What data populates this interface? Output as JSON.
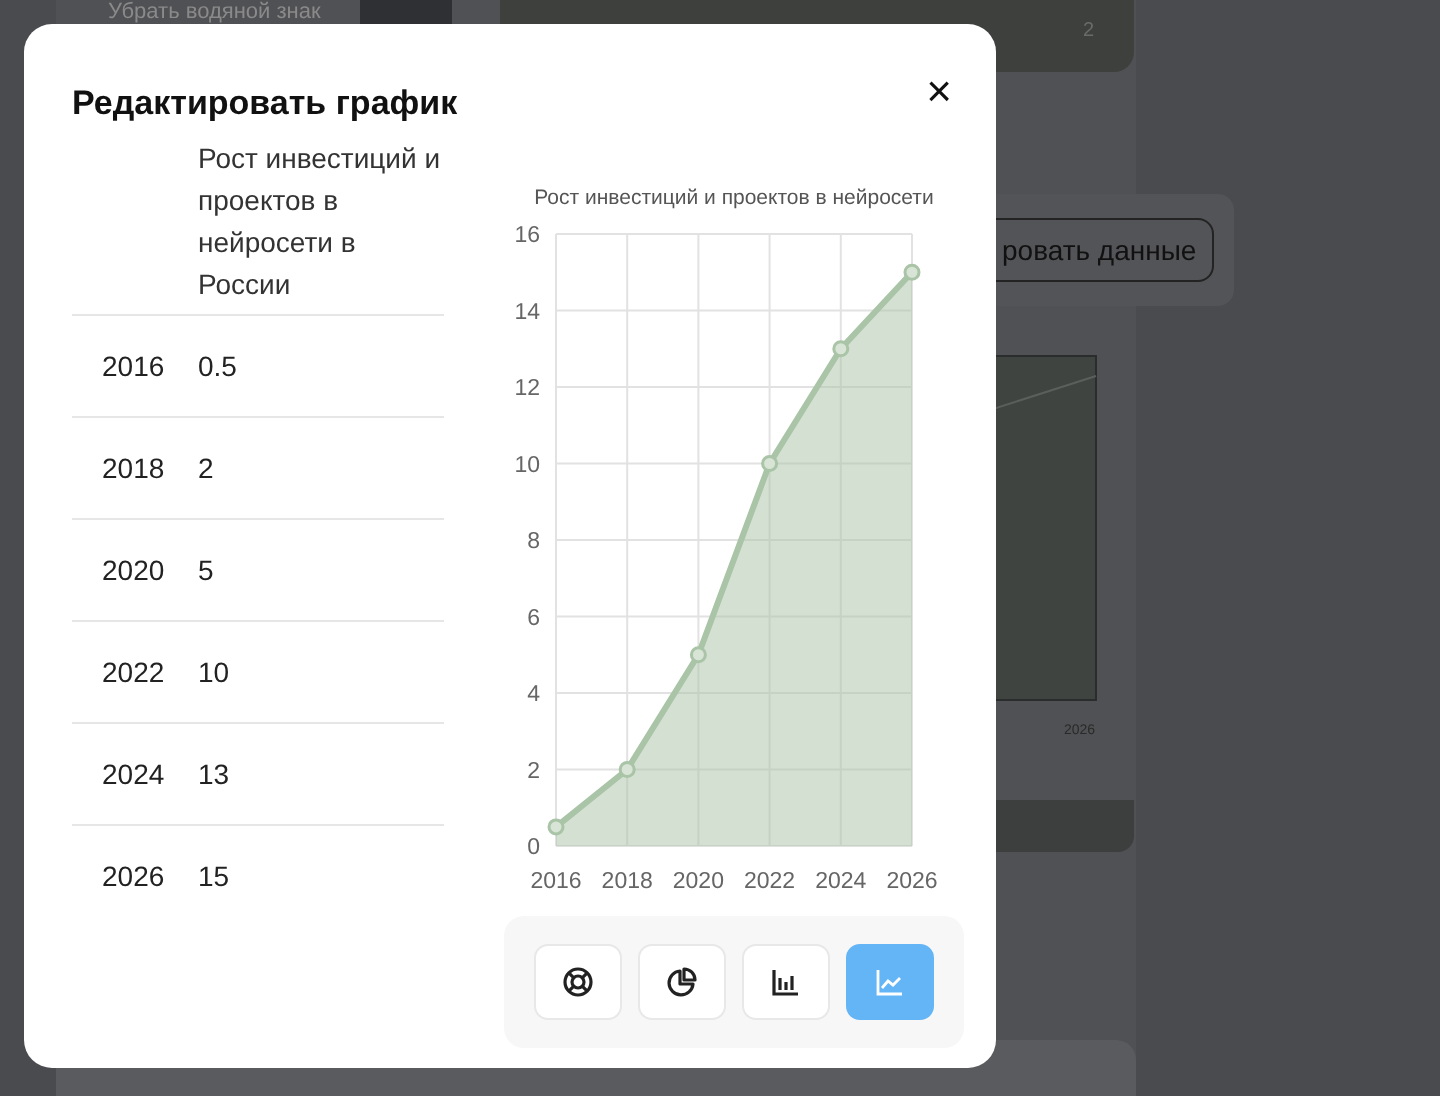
{
  "background": {
    "watermark_label": "Убрать водяной знак",
    "page_number": "2",
    "data_button": "ровать данные",
    "chart_tick": "2026"
  },
  "dialog": {
    "title": "Редактировать график",
    "close": "×",
    "table": {
      "columns": [
        "",
        "Рост инвестиций и проектов в нейросети в России"
      ],
      "rows": [
        {
          "year": "2016",
          "value": "0.5"
        },
        {
          "year": "2018",
          "value": "2"
        },
        {
          "year": "2020",
          "value": "5"
        },
        {
          "year": "2022",
          "value": "10"
        },
        {
          "year": "2024",
          "value": "13"
        },
        {
          "year": "2026",
          "value": "15"
        }
      ]
    },
    "chart_data": {
      "type": "area",
      "title": "Рост инвестиций и проектов в нейросети",
      "categories": [
        "2016",
        "2018",
        "2020",
        "2022",
        "2024",
        "2026"
      ],
      "series": [
        {
          "color": "#a9c4a6",
          "values": [
            0.5,
            2,
            5,
            10,
            13,
            15
          ]
        }
      ],
      "grid": true,
      "ylim": [
        0,
        16
      ],
      "yticks": [
        0,
        2,
        4,
        6,
        8,
        10,
        12,
        14,
        16
      ]
    },
    "chart_types": [
      {
        "kind": "lifebuoy",
        "selected": false
      },
      {
        "kind": "pie",
        "selected": false
      },
      {
        "kind": "bar",
        "selected": false
      },
      {
        "kind": "line",
        "selected": true
      }
    ]
  }
}
